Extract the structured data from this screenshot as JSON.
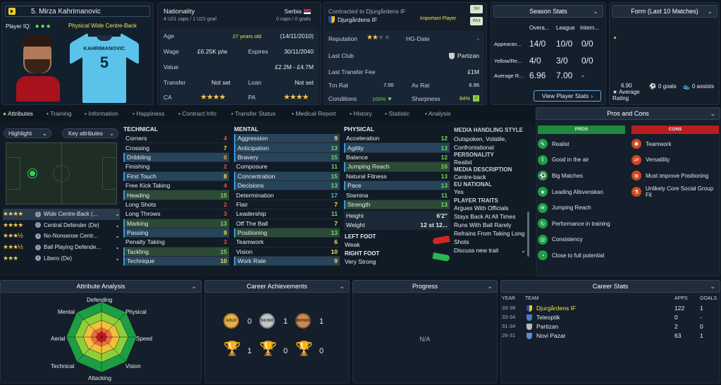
{
  "player": {
    "name": "5. Mirza Kahrimanovic",
    "player_iq_label": "Player IQ:",
    "role": "Physical Wide Centre-Back",
    "shirt_name": "KAHRIMANOVIC",
    "shirt_number": "5"
  },
  "info": {
    "nationality_label": "Nationality",
    "nationality": "Serbia",
    "caps_u21": "4 U21 caps / 1 U21 goal",
    "caps": "0 caps / 0 goals",
    "age_label": "Age",
    "age": "27 years old",
    "dob": "(14/11/2010)",
    "wage_label": "Wage",
    "wage": "£6.25K p/w",
    "expires_label": "Expires",
    "expires": "30/11/2040",
    "value_label": "Value",
    "value": "£2.2M - £4.7M",
    "transfer_label": "Transfer",
    "transfer": "Not set",
    "loan_label": "Loan",
    "loan": "Not set",
    "ca_label": "CA",
    "pa_label": "PA",
    "ca_stars": "★★★★",
    "pa_stars": "★★★★"
  },
  "club": {
    "contracted_label": "Contracted to Djurgårdens IF",
    "club_name": "Djurgårdens IF",
    "status": "Important Player",
    "badge_sh": "SH",
    "badge_wnt": "Wnt",
    "reputation_label": "Reputation",
    "reputation_stars": "★★",
    "hg_label": "HG-Date",
    "hg_value": "-",
    "last_club_label": "Last Club",
    "last_club": "Partizan",
    "last_fee_label": "Last Transfer Fee",
    "last_fee": "£1M",
    "trn_label": "Trn Rat",
    "trn_value": "7.00",
    "av_label": "Av Rat",
    "av_value": "6.96",
    "conditions_label": "Conditions",
    "conditions": "100%",
    "sharpness_label": "Sharpness",
    "sharpness": "84%"
  },
  "season": {
    "title": "Season Stats",
    "cols": [
      "Overa...",
      "League",
      "Intern..."
    ],
    "rows": [
      {
        "label": "Appearan...",
        "vals": [
          "14/0",
          "10/0",
          "0/0"
        ]
      },
      {
        "label": "Yellow/Re...",
        "vals": [
          "4/0",
          "3/0",
          "0/0"
        ]
      },
      {
        "label": "Average R...",
        "vals": [
          "6.96",
          "7.00",
          "-"
        ]
      }
    ],
    "button": "View Player Stats"
  },
  "form": {
    "title": "Form (Last 10 Matches)",
    "rating": "6.90",
    "rating_label": "Average Rating",
    "goals": "0 goals",
    "assists": "0 assists"
  },
  "tabs": [
    "Attributes",
    "Training",
    "Information",
    "Happiness",
    "Contract Info",
    "Transfer Status",
    "Medical Report",
    "History",
    "Statistic",
    "Analysis"
  ],
  "controls": {
    "highlight": "Highlight",
    "key_attributes": "Key attributes"
  },
  "positions": [
    {
      "stars": "★★★★",
      "name": "Wide Centre-Back (..."
    },
    {
      "stars": "★★★★",
      "name": "Central Defender (De)"
    },
    {
      "stars": "★★★½",
      "name": "No-Nonsense Centr..."
    },
    {
      "stars": "★★★½",
      "name": "Ball Playing Defende..."
    },
    {
      "stars": "★★★",
      "name": "Libero (De)"
    }
  ],
  "technical": {
    "title": "TECHNICAL",
    "items": [
      {
        "name": "Corners",
        "value": "4"
      },
      {
        "name": "Crossing",
        "value": "7"
      },
      {
        "name": "Dribbling",
        "value": "6"
      },
      {
        "name": "Finishing",
        "value": "2"
      },
      {
        "name": "First Touch",
        "value": "8"
      },
      {
        "name": "Free Kick Taking",
        "value": "4"
      },
      {
        "name": "Heading",
        "value": "15"
      },
      {
        "name": "Long Shots",
        "value": "2"
      },
      {
        "name": "Long Throws",
        "value": "3"
      },
      {
        "name": "Marking",
        "value": "13"
      },
      {
        "name": "Passing",
        "value": "9"
      },
      {
        "name": "Penalty Taking",
        "value": "3"
      },
      {
        "name": "Tackling",
        "value": "15"
      },
      {
        "name": "Technique",
        "value": "10"
      }
    ]
  },
  "mental": {
    "title": "MENTAL",
    "items": [
      {
        "name": "Aggression",
        "value": "9"
      },
      {
        "name": "Anticipation",
        "value": "13"
      },
      {
        "name": "Bravery",
        "value": "15"
      },
      {
        "name": "Composure",
        "value": "11"
      },
      {
        "name": "Concentration",
        "value": "15"
      },
      {
        "name": "Decisions",
        "value": "13"
      },
      {
        "name": "Determination",
        "value": "17"
      },
      {
        "name": "Flair",
        "value": "7"
      },
      {
        "name": "Leadership",
        "value": "11"
      },
      {
        "name": "Off The Ball",
        "value": "7"
      },
      {
        "name": "Positioning",
        "value": "13"
      },
      {
        "name": "Teamwork",
        "value": "6"
      },
      {
        "name": "Vision",
        "value": "10"
      },
      {
        "name": "Work Rate",
        "value": "9"
      }
    ]
  },
  "physical": {
    "title": "PHYSICAL",
    "items": [
      {
        "name": "Acceleration",
        "value": "12"
      },
      {
        "name": "Agility",
        "value": "13"
      },
      {
        "name": "Balance",
        "value": "12"
      },
      {
        "name": "Jumping Reach",
        "value": "16"
      },
      {
        "name": "Natural Fitness",
        "value": "13"
      },
      {
        "name": "Pace",
        "value": "13"
      },
      {
        "name": "Stamina",
        "value": "11"
      },
      {
        "name": "Strength",
        "value": "13"
      }
    ],
    "height_label": "Height",
    "height": "6'2\"",
    "weight_label": "Weight",
    "weight": "12 st 12...",
    "left_foot_label": "LEFT FOOT",
    "left_foot": "Weak",
    "right_foot_label": "RIGHT FOOT",
    "right_foot": "Very Strong"
  },
  "media": {
    "style_label": "MEDIA HANDLING STYLE",
    "style": "Outspoken, Volatile, Confrontational",
    "personality_label": "PERSONALITY",
    "personality": "Realist",
    "description_label": "MEDIA DESCRIPTION",
    "description": "Centre-back",
    "eu_label": "EU NATIONAL",
    "eu": "Yes",
    "traits_label": "PLAYER TRAITS",
    "traits": [
      "Argues With Officials",
      "Stays Back At All Times",
      "Runs With Ball Rarely",
      "Refrains From Taking Long Shots"
    ],
    "discuss": "Discuss new trait"
  },
  "pros_cons": {
    "title": "Pros and Cons",
    "pros_label": "PROS",
    "cons_label": "CONS",
    "pros": [
      "Realist",
      "Good in the air",
      "Big Matches",
      "Leading Allsvenskan",
      "Jumping Reach",
      "Performance in training",
      "Consistency",
      "Close to full potential"
    ],
    "cons": [
      "Teamwork",
      "Versatility",
      "Must improve Positioning",
      "Unlikely Core Social Group Fit"
    ]
  },
  "analysis": {
    "title": "Attribute Analysis",
    "labels": [
      "Defending",
      "Physical",
      "Speed",
      "Vision",
      "Attacking",
      "Technical",
      "Aerial",
      "Mental"
    ]
  },
  "achievements": {
    "title": "Career Achievements",
    "medal_gold": "GOLD",
    "medal_silver": "SILVER",
    "medal_bronze": "BRONZE",
    "gold": "0",
    "silver": "1",
    "bronze": "1",
    "cup_gold": "1",
    "cup_silver": "0",
    "cup_bronze": "0"
  },
  "progress": {
    "title": "Progress",
    "value": "N/A"
  },
  "career": {
    "title": "Career Stats",
    "headers": [
      "YEAR",
      "TEAM",
      "APPS",
      "GOALS"
    ],
    "rows": [
      {
        "year": "33-38",
        "team": "Djurgårdens IF",
        "apps": "122",
        "goals": "1"
      },
      {
        "year": "33-34",
        "team": "Teleoptik",
        "apps": "0",
        "goals": "-"
      },
      {
        "year": "31-34",
        "team": "Partizan",
        "apps": "2",
        "goals": "0"
      },
      {
        "year": "26-31",
        "team": "Novi Pazar",
        "apps": "63",
        "goals": "1"
      }
    ]
  }
}
